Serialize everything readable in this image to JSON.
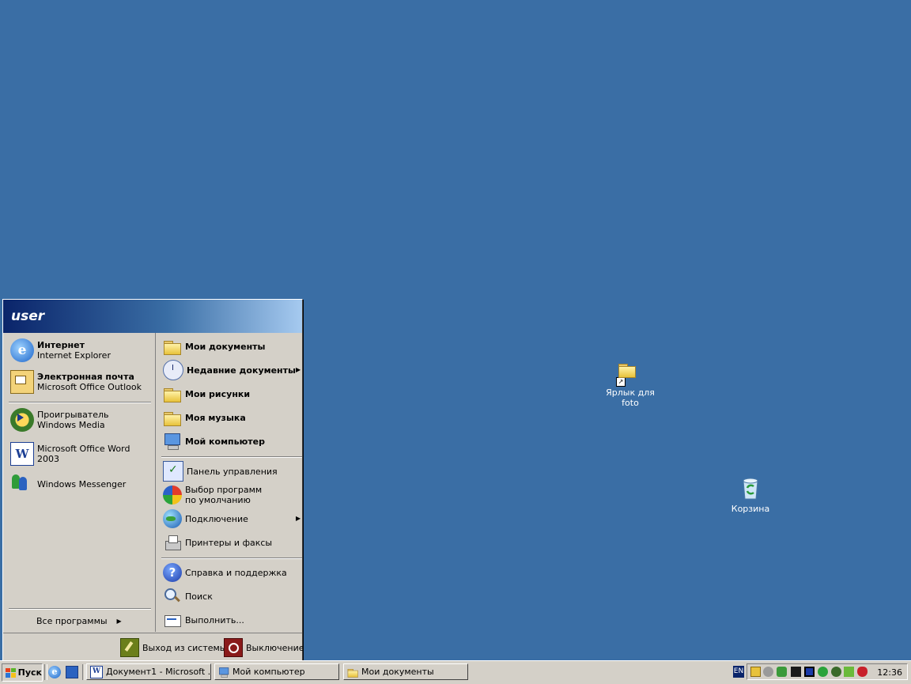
{
  "desktop": {
    "icons": [
      {
        "label": "Ярлык для foto",
        "icon": "folder-shortcut-icon"
      },
      {
        "label": "Корзина",
        "icon": "recycle-bin-icon"
      }
    ]
  },
  "start_menu": {
    "user_name": "user",
    "pinned": [
      {
        "title": "Интернет",
        "subtitle": "Internet Explorer",
        "icon": "internet-explorer-icon"
      },
      {
        "title": "Электронная почта",
        "subtitle": "Microsoft Office Outlook",
        "icon": "outlook-mail-icon"
      }
    ],
    "recent": [
      {
        "title": "Проигрыватель Windows Media",
        "icon": "windows-media-player-icon"
      },
      {
        "title": "Microsoft Office Word 2003",
        "icon": "word-icon"
      },
      {
        "title": "Windows Messenger",
        "icon": "messenger-icon"
      }
    ],
    "all_programs": "Все программы",
    "right": [
      {
        "label": "Мои документы",
        "icon": "folder-icon"
      },
      {
        "label": "Недавние документы",
        "icon": "recent-documents-icon"
      },
      {
        "label": "Мои рисунки",
        "icon": "folder-icon"
      },
      {
        "label": "Моя музыка",
        "icon": "folder-icon"
      },
      {
        "label": "Мой компьютер",
        "icon": "computer-icon"
      },
      {
        "label": "Панель управления",
        "icon": "control-panel-icon"
      },
      {
        "label": "Выбор программ по умолчанию",
        "icon": "default-programs-icon"
      },
      {
        "label": "Подключение",
        "icon": "network-globe-icon"
      },
      {
        "label": "Принтеры и факсы",
        "icon": "printer-icon"
      },
      {
        "label": "Справка и поддержка",
        "icon": "help-icon"
      },
      {
        "label": "Поиск",
        "icon": "search-icon"
      },
      {
        "label": "Выполнить...",
        "icon": "run-icon"
      }
    ],
    "logoff": "Выход из системы",
    "shutdown": "Выключение"
  },
  "taskbar": {
    "start_label": "Пуск",
    "windows": [
      {
        "label": "Документ1 - Microsoft ..."
      },
      {
        "label": "Мой компьютер"
      },
      {
        "label": "Мои документы"
      }
    ],
    "language": "EN",
    "clock": "12:36"
  },
  "colors": {
    "desktop": "#3a6ea5",
    "menu_face": "#d4d0c8",
    "header_dark": "#0a246a",
    "header_light": "#a6caf0"
  }
}
